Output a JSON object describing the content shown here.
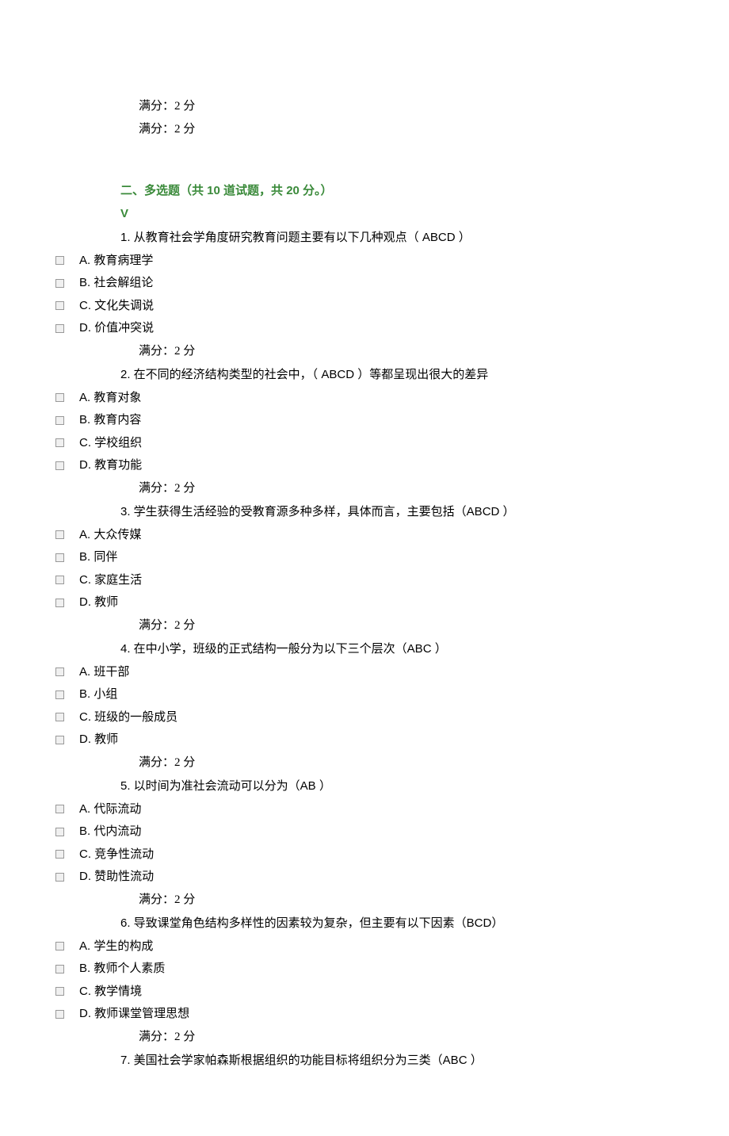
{
  "top_scores": [
    "满分：2 分",
    "满分：2 分"
  ],
  "section": {
    "title": "二、多选题（共 10 道试题，共 20 分。）",
    "mark": "V"
  },
  "questions": [
    {
      "text": "1.  从教育社会学角度研究教育问题主要有以下几种观点（   ABCD        ）",
      "options": [
        "A. 教育病理学",
        "B. 社会解组论",
        "C. 文化失调说",
        "D. 价值冲突说"
      ],
      "score": "满分：2 分"
    },
    {
      "text": "2. 在不同的经济结构类型的社会中，（    ABCD      ）等都呈现出很大的差异",
      "options": [
        "A. 教育对象",
        "B. 教育内容",
        "C. 学校组织",
        "D. 教育功能"
      ],
      "score": "满分：2 分"
    },
    {
      "text": "3.  学生获得生活经验的受教育源多种多样，具体而言，主要包括（ABCD ）",
      "options": [
        "A. 大众传媒",
        "B. 同伴",
        "C. 家庭生活",
        "D. 教师"
      ],
      "score": "满分：2 分"
    },
    {
      "text": "4.  在中小学，班级的正式结构一般分为以下三个层次（ABC ）",
      "options": [
        "A. 班干部",
        "B. 小组",
        "C. 班级的一般成员",
        "D. 教师"
      ],
      "score": "满分：2 分"
    },
    {
      "text": "5.  以时间为准社会流动可以分为（AB ）",
      "options": [
        "A. 代际流动",
        "B. 代内流动",
        "C. 竞争性流动",
        "D. 赞助性流动"
      ],
      "score": "满分：2 分"
    },
    {
      "text": "6.  导致课堂角色结构多样性的因素较为复杂，但主要有以下因素（BCD）",
      "options": [
        "A. 学生的构成",
        "B. 教师个人素质",
        "C. 教学情境",
        "D. 教师课堂管理思想"
      ],
      "score": "满分：2 分"
    },
    {
      "text": "7.  美国社会学家帕森斯根据组织的功能目标将组织分为三类（ABC ）",
      "options": [],
      "score": null
    }
  ]
}
